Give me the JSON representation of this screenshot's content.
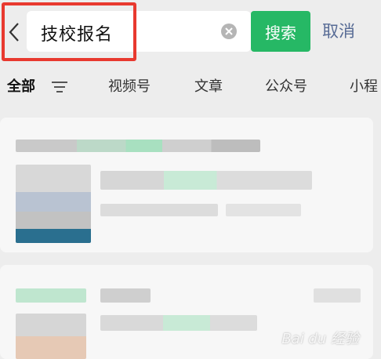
{
  "search": {
    "query": "技校报名",
    "submit_label": "搜索",
    "cancel_label": "取消"
  },
  "tabs": [
    {
      "label": "全部",
      "active": true
    },
    {
      "label": "视频号",
      "active": false
    },
    {
      "label": "文章",
      "active": false
    },
    {
      "label": "公众号",
      "active": false
    },
    {
      "label": "小程",
      "active": false
    }
  ],
  "colors": {
    "accent": "#26b865",
    "cancel": "#576b95",
    "highlight_border": "#e8392f"
  },
  "icons": [
    "back-chevron-icon",
    "clear-icon",
    "filter-icon"
  ]
}
